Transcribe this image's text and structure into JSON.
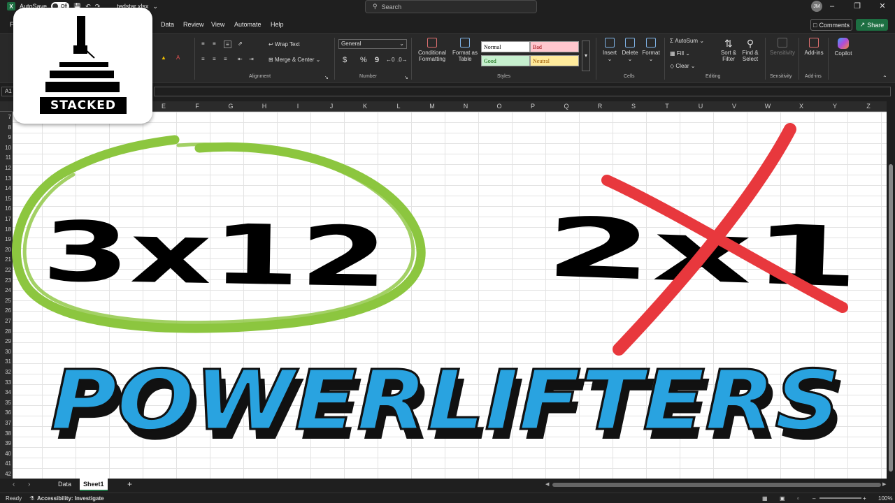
{
  "titlebar": {
    "autosave_label": "AutoSave",
    "toggle_state": "Off",
    "filename": "tedstar.xlsx",
    "search_placeholder": "Search",
    "user_initials": "JM"
  },
  "tabs": [
    "F",
    "Data",
    "Review",
    "View",
    "Automate",
    "Help"
  ],
  "actions": {
    "comments": "Comments",
    "share": "Share"
  },
  "ribbon": {
    "alignment": {
      "wrap_text": "Wrap Text",
      "merge_center": "Merge & Center",
      "label": "Alignment"
    },
    "number": {
      "format": "General",
      "currency": "$",
      "percent": "%",
      "comma": "9",
      "label": "Number"
    },
    "styles": {
      "conditional": "Conditional\nFormatting",
      "format_table": "Format as\nTable",
      "cells": [
        {
          "label": "Normal",
          "bg": "#ffffff",
          "fg": "#000000"
        },
        {
          "label": "Bad",
          "bg": "#ffc7ce",
          "fg": "#9c0006"
        },
        {
          "label": "Good",
          "bg": "#c6efce",
          "fg": "#006100"
        },
        {
          "label": "Neutral",
          "bg": "#ffeb9c",
          "fg": "#9c5700"
        }
      ],
      "label": "Styles"
    },
    "cells": {
      "insert": "Insert",
      "delete": "Delete",
      "format": "Format",
      "label": "Cells"
    },
    "editing": {
      "autosum": "AutoSum",
      "fill": "Fill",
      "clear": "Clear",
      "sort_filter": "Sort &\nFilter",
      "find_select": "Find &\nSelect",
      "label": "Editing"
    },
    "sensitivity": {
      "button": "Sensitivity",
      "label": "Sensitivity"
    },
    "addins": {
      "button": "Add-ins",
      "label": "Add-ins"
    },
    "copilot": "Copilot"
  },
  "namebox": "A1",
  "columns": [
    "E",
    "F",
    "G",
    "H",
    "I",
    "J",
    "K",
    "L",
    "M",
    "N",
    "O",
    "P",
    "Q",
    "R",
    "S",
    "T",
    "U",
    "V",
    "W",
    "X",
    "Y",
    "Z"
  ],
  "rows": [
    "7",
    "8",
    "9",
    "10",
    "11",
    "12",
    "13",
    "14",
    "15",
    "16",
    "17",
    "18",
    "19",
    "20",
    "21",
    "22",
    "23",
    "24",
    "25",
    "26",
    "27",
    "28",
    "29",
    "30",
    "31",
    "32",
    "33",
    "34",
    "35",
    "36",
    "37",
    "38",
    "39",
    "40",
    "41",
    "42"
  ],
  "sheets": {
    "tab1": "Data",
    "tab2": "Sheet1",
    "add": "+"
  },
  "status": {
    "ready": "Ready",
    "accessibility": "Accessibility: Investigate",
    "zoom": "100%"
  },
  "logo": {
    "text": "STACKED"
  },
  "artwork": {
    "left_text": "3x12",
    "right_text": "2x1",
    "headline": "POWERLIFTERS",
    "circle_color": "#8cc63f",
    "cross_color": "#e8383d",
    "headline_color": "#29a3e0"
  }
}
